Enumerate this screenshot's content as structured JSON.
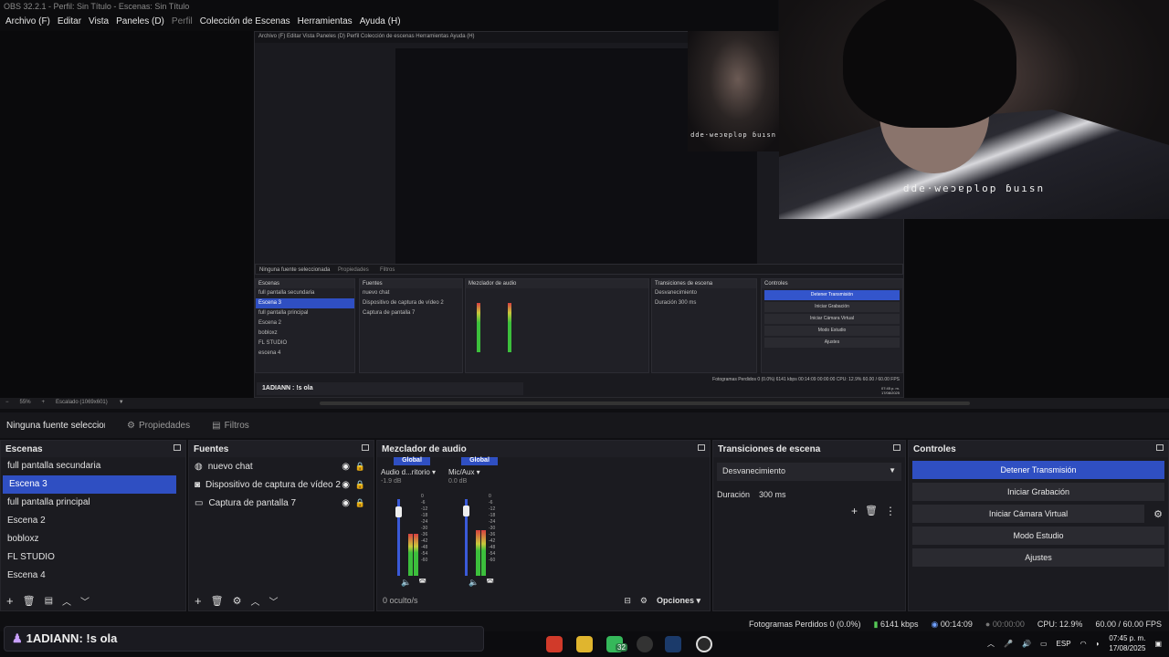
{
  "window": {
    "title": "OBS 32.2.1 - Perfil: Sin Título - Escenas: Sin Título"
  },
  "menu": [
    {
      "label": "Archivo (F)",
      "dim": false
    },
    {
      "label": "Editar",
      "dim": false
    },
    {
      "label": "Vista",
      "dim": false
    },
    {
      "label": "Paneles (D)",
      "dim": false
    },
    {
      "label": "Perfil",
      "dim": true
    },
    {
      "label": "Colección de Escenas",
      "dim": false
    },
    {
      "label": "Herramientas",
      "dim": false
    },
    {
      "label": "Ayuda (H)",
      "dim": false
    }
  ],
  "webcam": {
    "overlay_text": "dde·weɔɐplop ɓuısn"
  },
  "zoombar": {
    "zoom": "55%",
    "scale": "Escalado (1069x601)"
  },
  "source_bar": {
    "selected": "Ninguna fuente seleccionada",
    "properties": "Propiedades",
    "filters": "Filtros"
  },
  "scenes": {
    "title": "Escenas",
    "items": [
      "full pantalla secundaria",
      "Escena 3",
      "full pantalla principal",
      "Escena 2",
      "bobloxz",
      "FL STUDIO",
      "Escena 4"
    ],
    "selected_index": 1
  },
  "sources": {
    "title": "Fuentes",
    "items": [
      {
        "label": "nuevo chat",
        "icon": "browser-icon"
      },
      {
        "label": "Dispositivo de captura de vídeo 2",
        "icon": "camera-icon"
      },
      {
        "label": "Captura de pantalla 7",
        "icon": "monitor-icon"
      }
    ]
  },
  "mixer": {
    "title": "Mezclador de audio",
    "channels": [
      {
        "global": "Global",
        "name": "Audio d...ritorio",
        "db": "-1.9 dB",
        "level": 0.55
      },
      {
        "global": "Global",
        "name": "Mic/Aux",
        "db": "0.0 dB",
        "level": 0.6
      }
    ],
    "ticks": [
      "0",
      "-6",
      "-12",
      "-18",
      "-24",
      "-30",
      "-36",
      "-42",
      "-48",
      "-54",
      "-60"
    ],
    "hidden": "0 oculto/s",
    "options": "Opciones"
  },
  "transitions": {
    "title": "Transiciones de escena",
    "type": "Desvanecimiento",
    "duration_label": "Duración",
    "duration": "300 ms"
  },
  "controls": {
    "title": "Controles",
    "buttons": [
      "Detener Transmisión",
      "Iniciar Grabación",
      "Iniciar Cámara Virtual",
      "Modo Estudio",
      "Ajustes"
    ]
  },
  "status": {
    "dropped": "Fotogramas Perdidos 0 (0.0%)",
    "bitrate": "6141 kbps",
    "stream_time": "00:14:09",
    "rec_time": "00:00:00",
    "cpu": "CPU: 12.9%",
    "fps": "60.00 / 60.00 FPS"
  },
  "chat": {
    "user": "1ADIANN",
    "message": ": !s ola"
  },
  "taskbar": {
    "badge": "32",
    "lang": "ESP",
    "time": "07:45 p. m.",
    "date": "17/08/2025"
  },
  "nested": {
    "title": "OBS 32.2.1 - Perfil: Sin Título - Escenas: Sin Título",
    "menu": "Archivo (F)  Editar  Vista  Paneles (D)  Perfil  Colección de escenas  Herramientas  Ayuda (H)",
    "source_bar": "Ninguna fuente seleccionada",
    "properties": "Propiedades",
    "filters": "Filtros",
    "zoom": "55%",
    "scale": "Escalado (1069x601)",
    "scenes_title": "Escenas",
    "sources_title": "Fuentes",
    "mixer_title": "Mezclador de audio",
    "transitions_title": "Transiciones de escena",
    "controls_title": "Controles",
    "scenes": [
      "full pantalla secundaria",
      "Escena 3",
      "full pantalla principal",
      "Escena 2",
      "bobloxz",
      "FL STUDIO",
      "escena 4"
    ],
    "sources": [
      "nuevo chat",
      "Dispositivo de captura de vídeo 2",
      "Captura de pantalla 7"
    ],
    "transition_type": "Desvanecimiento",
    "duration_label": "Duración",
    "duration": "300 ms",
    "controls": [
      "Detener Transmisión",
      "Iniciar Grabación",
      "Iniciar Cámara Virtual",
      "Modo Estudio",
      "Ajustes"
    ],
    "chat": "1ADIANN : !s ola",
    "status": "Fotogramas Perdidos 0 (0.0%)   6141 kbps   00:14:09   00:00:00   CPU: 12.9%   60.00 / 60.00 FPS",
    "clock": "07:45 p. m.",
    "date": "17/08/2025"
  }
}
